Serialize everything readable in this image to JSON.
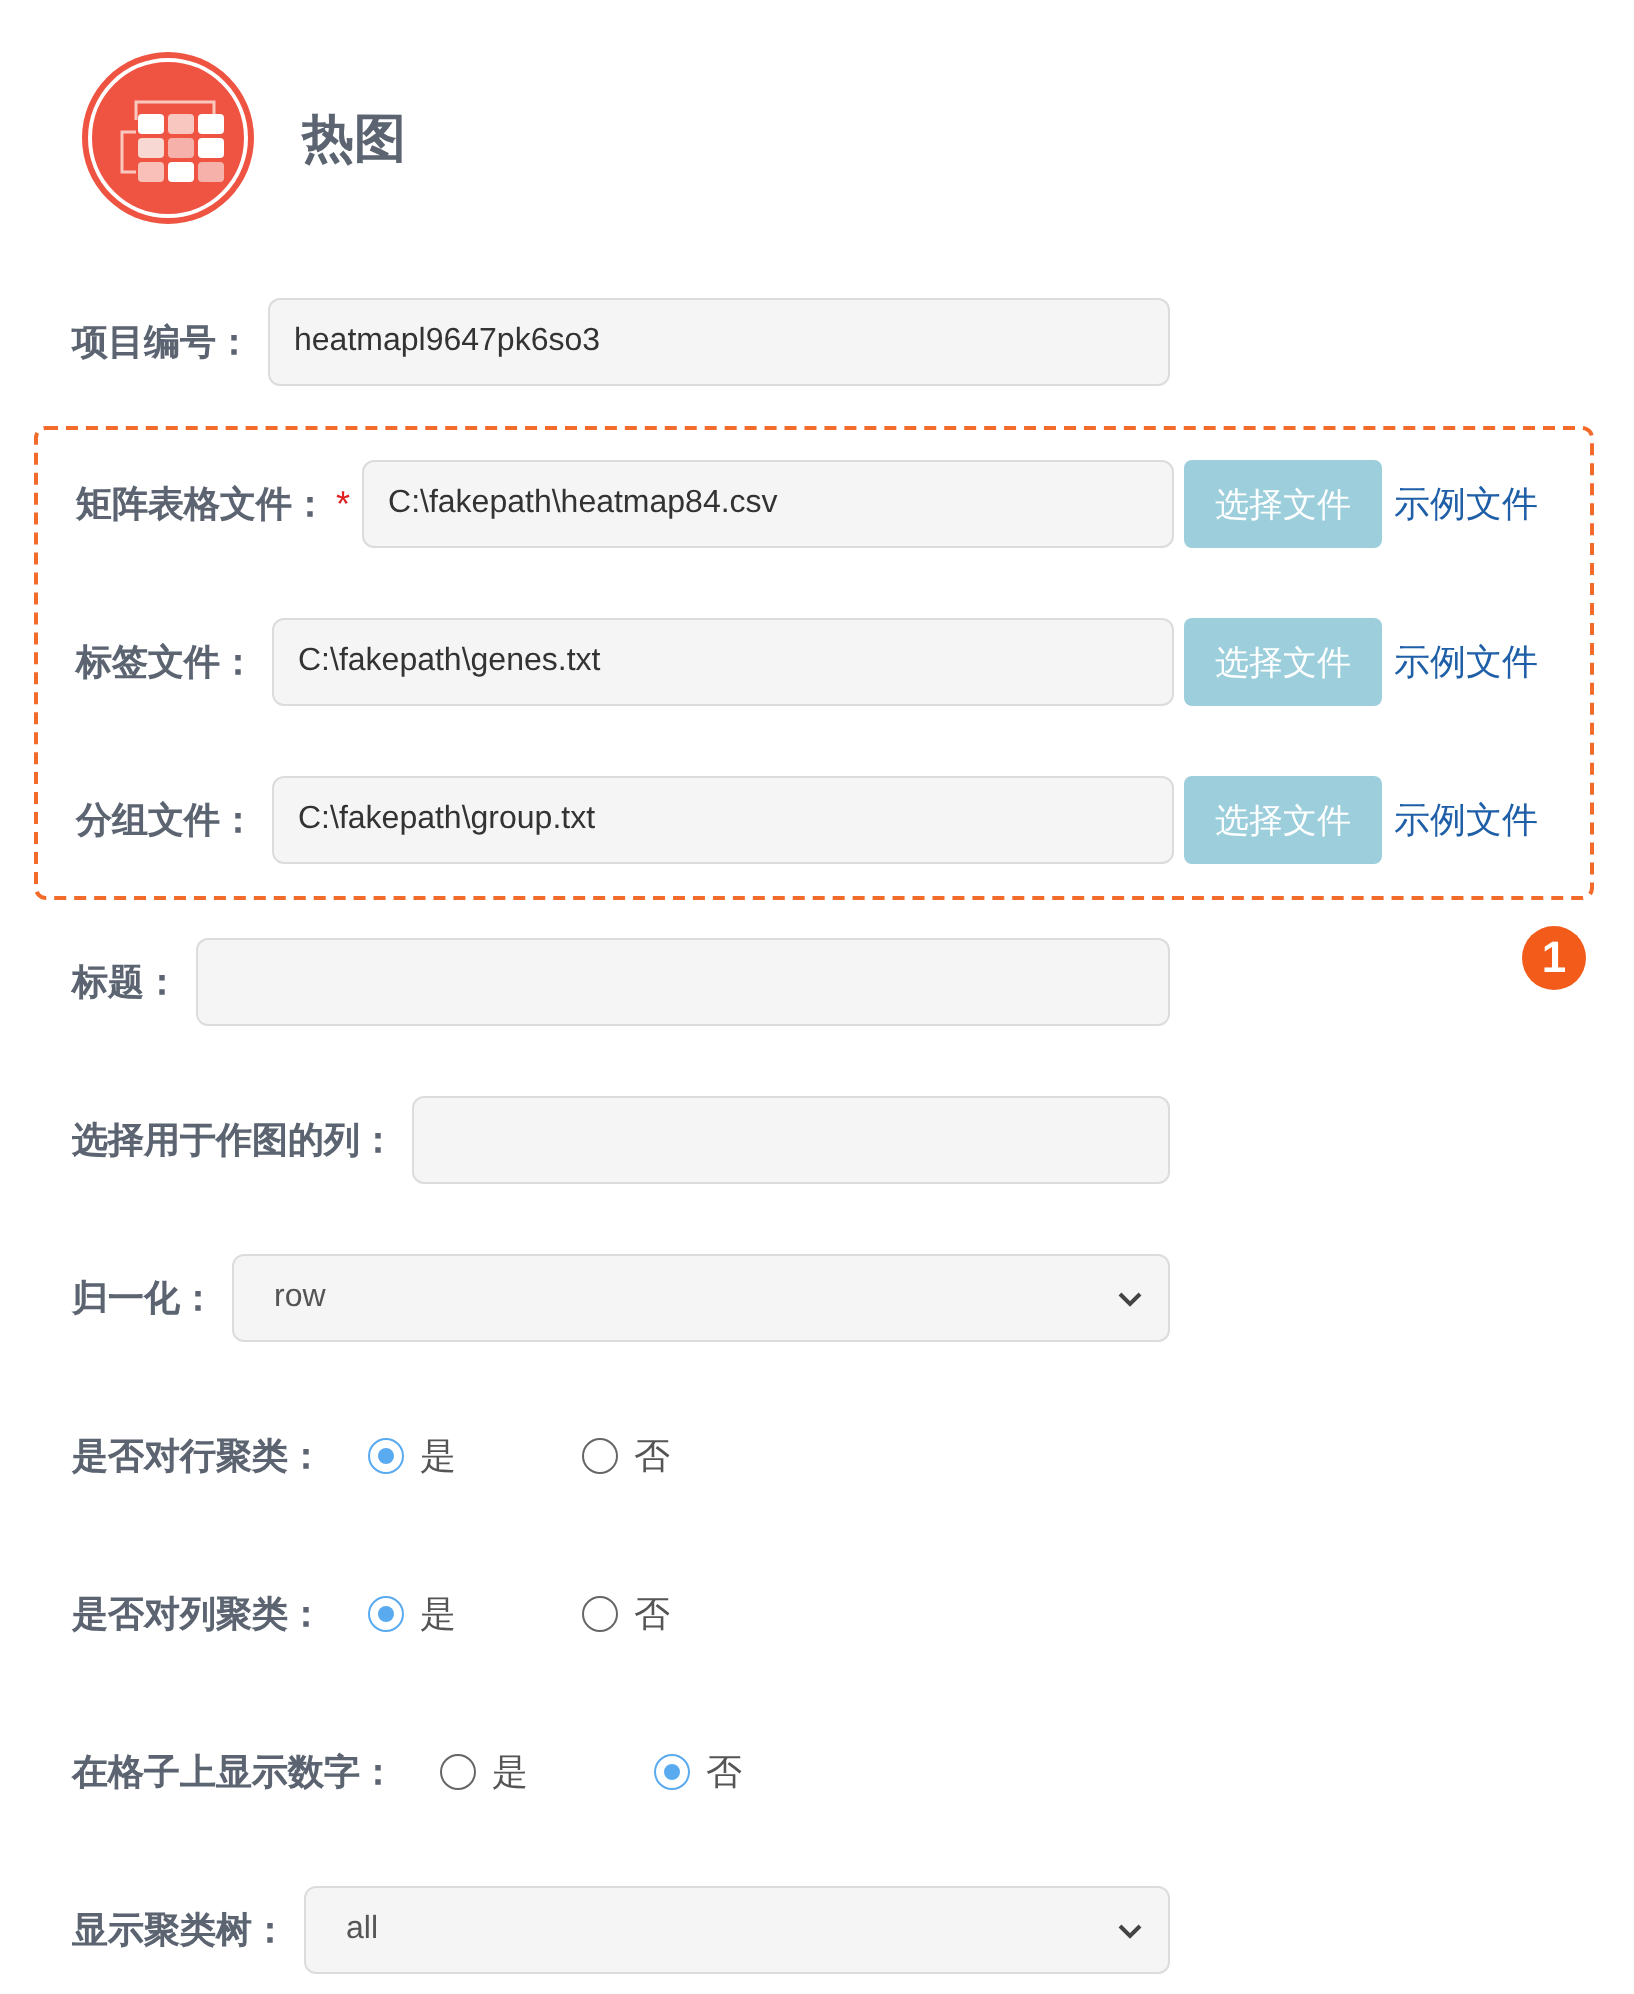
{
  "header": {
    "title": "热图"
  },
  "fields": [
    {
      "kind": "text",
      "label": "项目编号：",
      "value": "heatmapl9647pk6so3"
    },
    {
      "kind": "file_group",
      "marker": "1",
      "items": [
        {
          "label": "矩阵表格文件：",
          "required_mark": "*",
          "value": "C:\\fakepath\\heatmap84.csv",
          "button": "选择文件",
          "link": "示例文件"
        },
        {
          "label": "标签文件：",
          "value": "C:\\fakepath\\genes.txt",
          "button": "选择文件",
          "link": "示例文件"
        },
        {
          "label": "分组文件：",
          "value": "C:\\fakepath\\group.txt",
          "button": "选择文件",
          "link": "示例文件"
        }
      ]
    },
    {
      "kind": "text",
      "label": "标题："
    },
    {
      "kind": "text",
      "label": "选择用于作图的列："
    },
    {
      "kind": "select",
      "label": "归一化：",
      "value": "row"
    },
    {
      "kind": "radio",
      "label": "是否对行聚类：",
      "options": [
        {
          "label": "是",
          "selected": true
        },
        {
          "label": "否",
          "selected": false
        }
      ]
    },
    {
      "kind": "radio",
      "label": "是否对列聚类：",
      "options": [
        {
          "label": "是",
          "selected": true
        },
        {
          "label": "否",
          "selected": false
        }
      ]
    },
    {
      "kind": "radio",
      "label": "在格子上显示数字：",
      "options": [
        {
          "label": "是",
          "selected": false
        },
        {
          "label": "否",
          "selected": true
        }
      ]
    },
    {
      "kind": "select",
      "label": "显示聚类树：",
      "value": "all"
    }
  ]
}
